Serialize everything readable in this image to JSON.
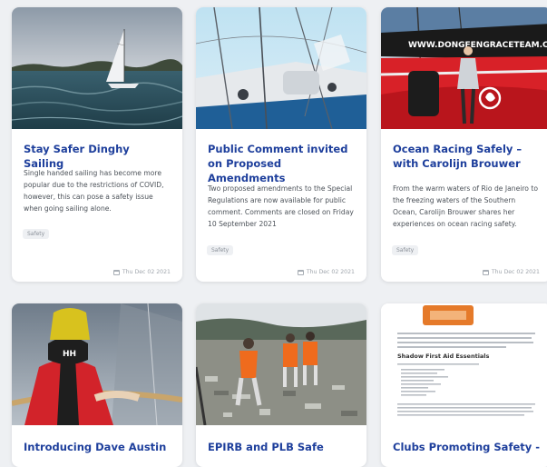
{
  "cards": [
    {
      "title": "Stay Safer Dinghy Sailing",
      "excerpt": "Single handed sailing has become more popular due to the restrictions of COVID, however, this can pose a safety issue when going sailing alone.",
      "tag": "Safety",
      "date": "Thu Dec 02 2021",
      "image_icon": "dinghy-sailing-photo"
    },
    {
      "title": "Public Comment invited on Proposed Amendments",
      "excerpt": "Two proposed amendments to the Special Regulations are now available for public comment. Comments are closed on Friday 10 September 2021",
      "tag": "Safety",
      "date": "Thu Dec 02 2021",
      "image_icon": "yacht-deck-rigging-photo"
    },
    {
      "title": "Ocean Racing Safely – with Carolijn Brouwer",
      "excerpt": "From the warm waters of Rio de Janeiro to the freezing waters of the Southern Ocean, Carolijn Brouwer shares her experiences on ocean racing safety.",
      "tag": "Safety",
      "date": "Thu Dec 02 2021",
      "image_icon": "ocean-race-sailor-photo",
      "image_text": "WWW.DONGFENGRACETEAM.COM"
    },
    {
      "title": "Introducing Dave Austin",
      "image_icon": "sailor-at-helm-photo",
      "image_text": "HH"
    },
    {
      "title": "EPIRB and PLB Safe",
      "image_icon": "landfill-search-photo"
    },
    {
      "title": "Clubs Promoting Safety -",
      "image_icon": "club-safety-document-photo",
      "image_text": "Shadow First Aid Essentials"
    }
  ],
  "colors": {
    "title": "#1e3f9c",
    "text": "#4c5259",
    "page_background": "#eef0f3",
    "card_background": "#ffffff"
  }
}
